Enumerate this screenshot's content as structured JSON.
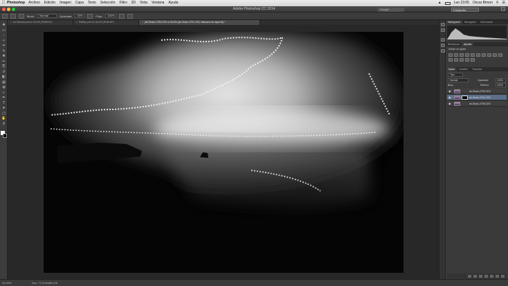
{
  "menubar": {
    "app_name": "Photoshop",
    "items": [
      "Archivo",
      "Edición",
      "Imagen",
      "Capa",
      "Texto",
      "Selección",
      "Filtro",
      "3D",
      "Vista",
      "Ventana",
      "Ayuda"
    ],
    "right": {
      "clock": "Lun 23:05",
      "user": "Oscar Bimon"
    }
  },
  "window": {
    "title": "Adobe Photoshop CC 2014",
    "search_placeholder": "Google",
    "workspace": "Fotografía"
  },
  "options_bar": {
    "mode_label": "Modo:",
    "mode_value": "Normal",
    "opacity_label": "Opacidad:",
    "opacity_value": "40%",
    "flow_label": "Flujo:",
    "flow_value": "100%"
  },
  "tabs": [
    {
      "label": "Avi Boseia prof s2 33,3% (RGB/16*)",
      "active": false
    },
    {
      "label": "Reflejo prof s2 33,3% (RGB/16*)",
      "active": false
    },
    {
      "label": "(dit-Shalo-2759.CR2 al 33,3% (ak-Shalo-2791.CR2, Máscara de capa/16) *",
      "active": true
    }
  ],
  "panels": {
    "top_tabs": [
      "Histograma",
      "Navegador",
      "Información"
    ],
    "adjust_tabs": [
      "Bibliotecas",
      "Ajustes"
    ],
    "adjust_title": "Añadir un ajuste",
    "layer_tabs": [
      "Capas",
      "Canales",
      "Trazados"
    ],
    "blend_mode": "Normal",
    "opacity_label": "Opacidad:",
    "opacity_value": "100%",
    "lock_label": "Bloq.:",
    "fill_label": "Relleno:",
    "fill_value": "100%",
    "kind_label": "Tipo",
    "layers": [
      {
        "name": "ak-Shalo-2759.CR2",
        "selected": false,
        "mask": false
      },
      {
        "name": "ak-Shalo-2791.CR2",
        "selected": true,
        "mask": true
      },
      {
        "name": "ak-Shalo-2758.CR2",
        "selected": false,
        "mask": false
      }
    ]
  },
  "status": {
    "zoom": "33,33%",
    "doc": "Doc: 77,8 M/489,6 M"
  },
  "colors": {
    "panel_bg": "#3a3a3a",
    "selected_layer": "#5b6f8a",
    "canvas_bg": "#282828"
  }
}
